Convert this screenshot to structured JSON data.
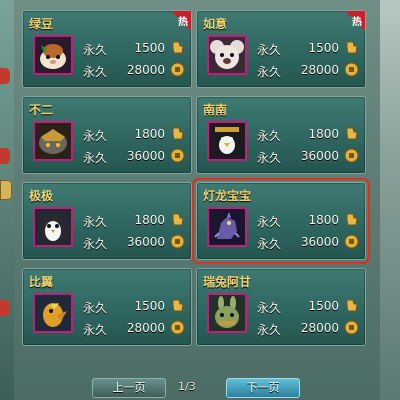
{
  "pets": [
    {
      "name": "绿豆",
      "hot": true,
      "duration1": "永久",
      "price1": "1500",
      "currency1": "gold-ingot",
      "duration2": "永久",
      "price2": "28000",
      "currency2": "coin",
      "avatar": "hamster-avatar"
    },
    {
      "name": "如意",
      "hot": true,
      "duration1": "永久",
      "price1": "1500",
      "currency1": "gold-ingot",
      "duration2": "永久",
      "price2": "28000",
      "currency2": "coin",
      "avatar": "koala-avatar"
    },
    {
      "name": "不二",
      "hot": false,
      "duration1": "永久",
      "price1": "1800",
      "currency1": "gold-ingot",
      "duration2": "永久",
      "price2": "36000",
      "currency2": "coin",
      "avatar": "armored-beast-avatar"
    },
    {
      "name": "南南",
      "hot": false,
      "duration1": "永久",
      "price1": "1800",
      "currency1": "gold-ingot",
      "duration2": "永久",
      "price2": "36000",
      "currency2": "coin",
      "avatar": "penguin-avatar"
    },
    {
      "name": "极极",
      "hot": false,
      "duration1": "永久",
      "price1": "1800",
      "currency1": "gold-ingot",
      "duration2": "永久",
      "price2": "36000",
      "currency2": "coin",
      "avatar": "baby-penguin-avatar"
    },
    {
      "name": "灯龙宝宝",
      "hot": false,
      "selected": true,
      "duration1": "永久",
      "price1": "1800",
      "currency1": "gold-ingot",
      "duration2": "永久",
      "price2": "36000",
      "currency2": "coin",
      "avatar": "dragon-avatar"
    },
    {
      "name": "比翼",
      "hot": false,
      "duration1": "永久",
      "price1": "1500",
      "currency1": "gold-ingot",
      "duration2": "永久",
      "price2": "28000",
      "currency2": "coin",
      "avatar": "bird-avatar"
    },
    {
      "name": "瑞兔阿甘",
      "hot": false,
      "duration1": "永久",
      "price1": "1500",
      "currency1": "gold-ingot",
      "duration2": "永久",
      "price2": "28000",
      "currency2": "coin",
      "avatar": "rabbit-avatar"
    }
  ],
  "hot_label": "热",
  "pager": {
    "prev": "上一页",
    "next": "下一页",
    "indicator": "1/3"
  },
  "colors": {
    "name": "#f0d36a",
    "selected_outline": "#e0301f",
    "hot_ribbon": "#c8202a",
    "avatar_border": "#c21f7a"
  }
}
